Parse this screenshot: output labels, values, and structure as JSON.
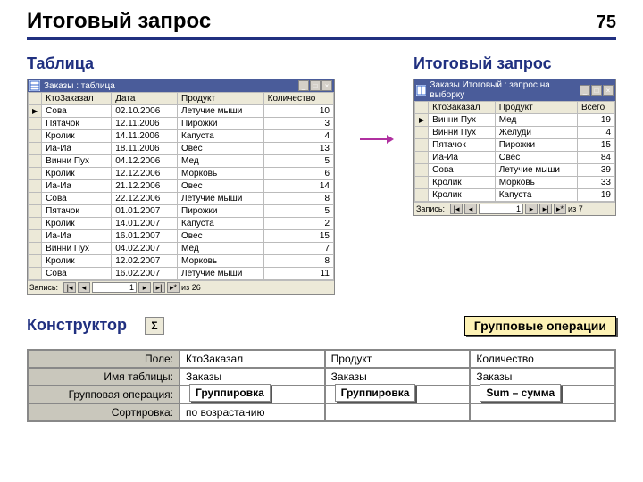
{
  "page_number": "75",
  "title": "Итоговый запрос",
  "sections": {
    "table": "Таблица",
    "summary": "Итоговый запрос",
    "designer": "Конструктор"
  },
  "sigma_icon": "Σ",
  "callouts": {
    "group_ops": "Групповые операции",
    "grouping1": "Группировка",
    "grouping2": "Группировка",
    "sum": "Sum – сумма"
  },
  "left_window": {
    "title": "Заказы : таблица",
    "columns": [
      "",
      "КтоЗаказал",
      "Дата",
      "Продукт",
      "Количество"
    ],
    "rows": [
      [
        "▶",
        "Сова",
        "02.10.2006",
        "Летучие мыши",
        "10"
      ],
      [
        "",
        "Пятачок",
        "12.11.2006",
        "Пирожки",
        "3"
      ],
      [
        "",
        "Кролик",
        "14.11.2006",
        "Капуста",
        "4"
      ],
      [
        "",
        "Иа-Иа",
        "18.11.2006",
        "Овес",
        "13"
      ],
      [
        "",
        "Винни Пух",
        "04.12.2006",
        "Мед",
        "5"
      ],
      [
        "",
        "Кролик",
        "12.12.2006",
        "Морковь",
        "6"
      ],
      [
        "",
        "Иа-Иа",
        "21.12.2006",
        "Овес",
        "14"
      ],
      [
        "",
        "Сова",
        "22.12.2006",
        "Летучие мыши",
        "8"
      ],
      [
        "",
        "Пятачок",
        "01.01.2007",
        "Пирожки",
        "5"
      ],
      [
        "",
        "Кролик",
        "14.01.2007",
        "Капуста",
        "2"
      ],
      [
        "",
        "Иа-Иа",
        "16.01.2007",
        "Овес",
        "15"
      ],
      [
        "",
        "Винни Пух",
        "04.02.2007",
        "Мед",
        "7"
      ],
      [
        "",
        "Кролик",
        "12.02.2007",
        "Морковь",
        "8"
      ],
      [
        "",
        "Сова",
        "16.02.2007",
        "Летучие мыши",
        "11"
      ]
    ],
    "nav": {
      "label": "Запись:",
      "pos": "1",
      "total": "из 26"
    }
  },
  "right_window": {
    "title": "Заказы Итоговый : запрос на выборку",
    "columns": [
      "",
      "КтоЗаказал",
      "Продукт",
      "Всего"
    ],
    "rows": [
      [
        "▶",
        "Винни Пух",
        "Мед",
        "19"
      ],
      [
        "",
        "Винни Пух",
        "Желуди",
        "4"
      ],
      [
        "",
        "Пятачок",
        "Пирожки",
        "15"
      ],
      [
        "",
        "Иа-Иа",
        "Овес",
        "84"
      ],
      [
        "",
        "Сова",
        "Летучие мыши",
        "39"
      ],
      [
        "",
        "Кролик",
        "Морковь",
        "33"
      ],
      [
        "",
        "Кролик",
        "Капуста",
        "19"
      ]
    ],
    "nav": {
      "label": "Запись:",
      "pos": "1",
      "total": "из 7"
    }
  },
  "design_grid": {
    "labels": [
      "Поле:",
      "Имя таблицы:",
      "Групповая операция:",
      "Сортировка:"
    ],
    "cols": [
      [
        "КтоЗаказал",
        "Заказы",
        "",
        "по возрастанию"
      ],
      [
        "Продукт",
        "Заказы",
        "",
        ""
      ],
      [
        "Количество",
        "Заказы",
        "",
        ""
      ]
    ]
  }
}
